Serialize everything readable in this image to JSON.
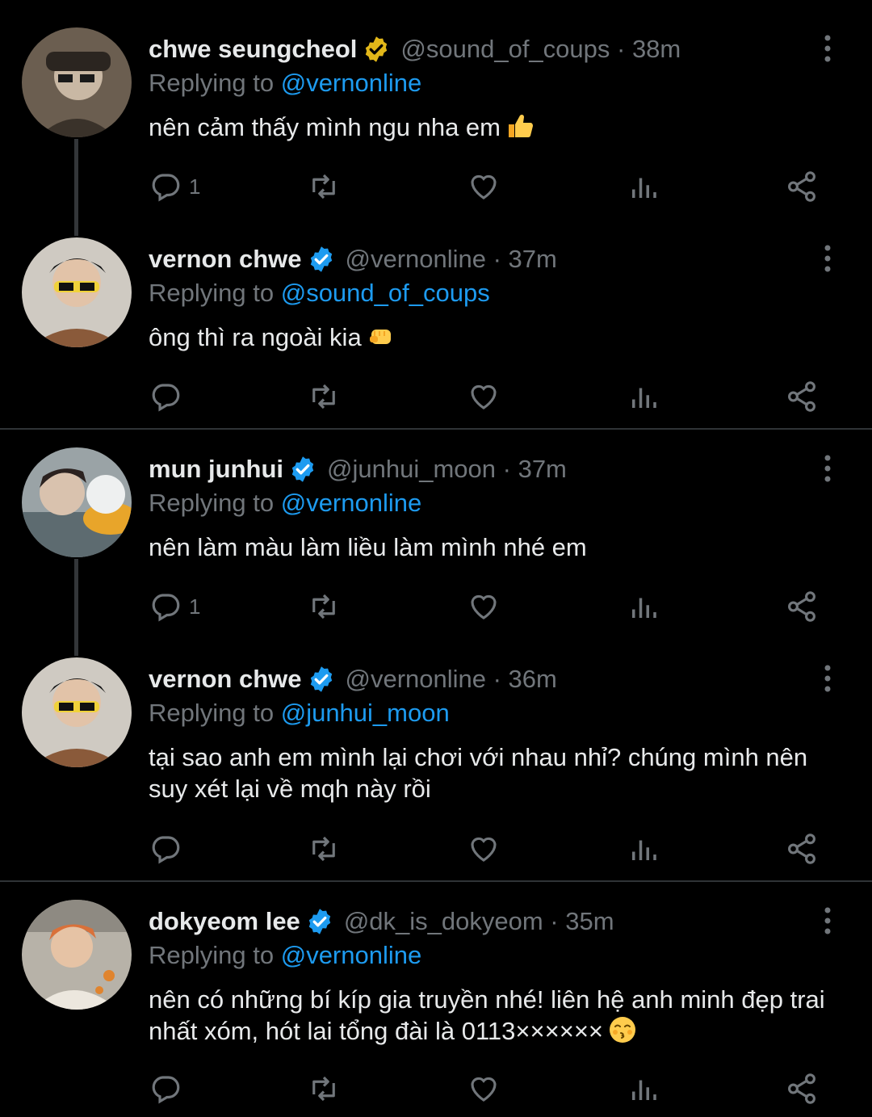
{
  "colors": {
    "background": "#000000",
    "text": "#e7e9ea",
    "muted": "#71767b",
    "accent": "#1d9bf0",
    "gold_badge": "#e2b719"
  },
  "reply_prefix": "Replying to",
  "tweets": [
    {
      "name": "chwe seungcheol",
      "badge": "gold-verified-icon",
      "handle_time": "@sound_of_coups · 38m",
      "reply_to": "@vernonline",
      "text": "nên cảm thấy mình ngu nha em",
      "emoji": "thumbs-up-emoji",
      "reply_count": "1"
    },
    {
      "name": "vernon chwe",
      "badge": "blue-verified-icon",
      "handle_time": "@vernonline · 37m",
      "reply_to": "@sound_of_coups",
      "text": "ông thì ra ngoài kia",
      "emoji": "fist-emoji",
      "reply_count": ""
    },
    {
      "name": "mun junhui",
      "badge": "blue-verified-icon",
      "handle_time": "@junhui_moon · 37m",
      "reply_to": "@vernonline",
      "text": "nên làm màu làm liều làm mình nhé em",
      "emoji": "",
      "reply_count": "1"
    },
    {
      "name": "vernon chwe",
      "badge": "blue-verified-icon",
      "handle_time": "@vernonline · 36m",
      "reply_to": "@junhui_moon",
      "text": "tại sao anh em mình lại chơi với nhau nhỉ? chúng mình nên suy xét lại về mqh này rồi",
      "emoji": "",
      "reply_count": ""
    },
    {
      "name": "dokyeom lee",
      "badge": "blue-verified-icon",
      "handle_time": "@dk_is_dokyeom · 35m",
      "reply_to": "@vernonline",
      "text": "nên có những bí kíp gia truyền nhé! liên hệ anh minh đẹp trai nhất xóm, hót lai tổng đài là 0113××××××",
      "emoji": "kissing-face-emoji",
      "reply_count": ""
    }
  ]
}
